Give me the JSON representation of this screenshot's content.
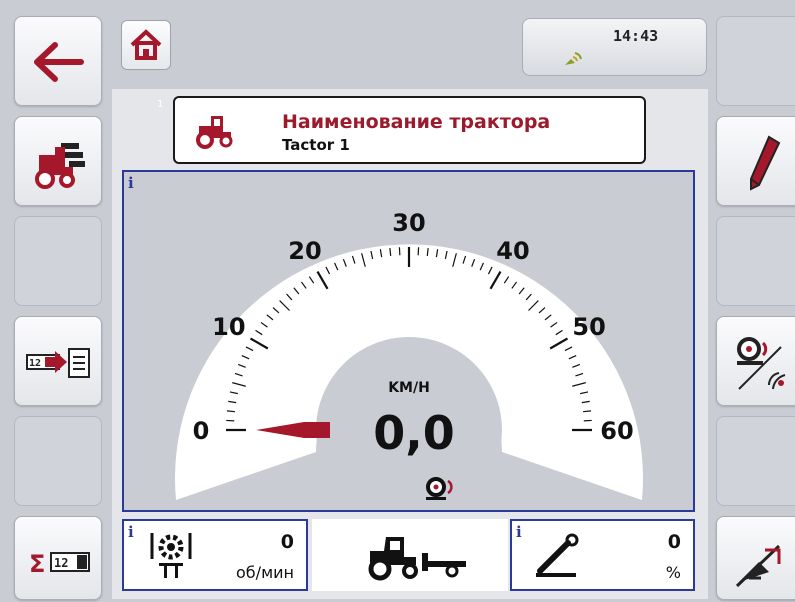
{
  "header": {
    "time": "14:43",
    "home_icon": "home-icon",
    "gps_icon": "gps-signal-icon"
  },
  "title": {
    "label": "Наименование трактора",
    "value": "Tactor 1",
    "index": "1",
    "icon": "tractor-icon"
  },
  "left_buttons": [
    {
      "name": "back-button",
      "icon": "back-arrow-icon"
    },
    {
      "name": "tractor-list-button",
      "icon": "tractor-list-icon"
    },
    {
      "name": "empty-left-3",
      "icon": null
    },
    {
      "name": "tractor-data-button",
      "icon": "counter-to-list-icon"
    },
    {
      "name": "empty-left-5",
      "icon": null
    },
    {
      "name": "totals-counter-button",
      "icon": "sum-counter-icon"
    }
  ],
  "right_buttons": [
    {
      "name": "empty-right-1",
      "icon": null
    },
    {
      "name": "edit-button",
      "icon": "pencil-icon"
    },
    {
      "name": "empty-right-3",
      "icon": null
    },
    {
      "name": "speed-source-button",
      "icon": "wheel-radar-icon"
    },
    {
      "name": "empty-right-5",
      "icon": null
    },
    {
      "name": "calibration-button",
      "icon": "calibrate-icon"
    }
  ],
  "speedometer": {
    "unit": "KM/H",
    "value": "0,0",
    "value_numeric": 0,
    "min": 0,
    "max": 60,
    "major_ticks": [
      "0",
      "10",
      "20",
      "30",
      "40",
      "50",
      "60"
    ],
    "source_icon": "wheel-sensor-icon",
    "info": "i"
  },
  "bottom": {
    "pto": {
      "info": "i",
      "value": "0",
      "unit": "об/мин",
      "icon": "pto-gear-icon"
    },
    "tractor": {
      "icon": "tractor-with-hitch-icon"
    },
    "implement": {
      "info": "i",
      "value": "0",
      "unit": "%",
      "icon": "hitch-position-icon"
    }
  },
  "colors": {
    "accent": "#9b1b2c",
    "frame_blue": "#2b3a9a",
    "background": "#c9ccd3"
  }
}
